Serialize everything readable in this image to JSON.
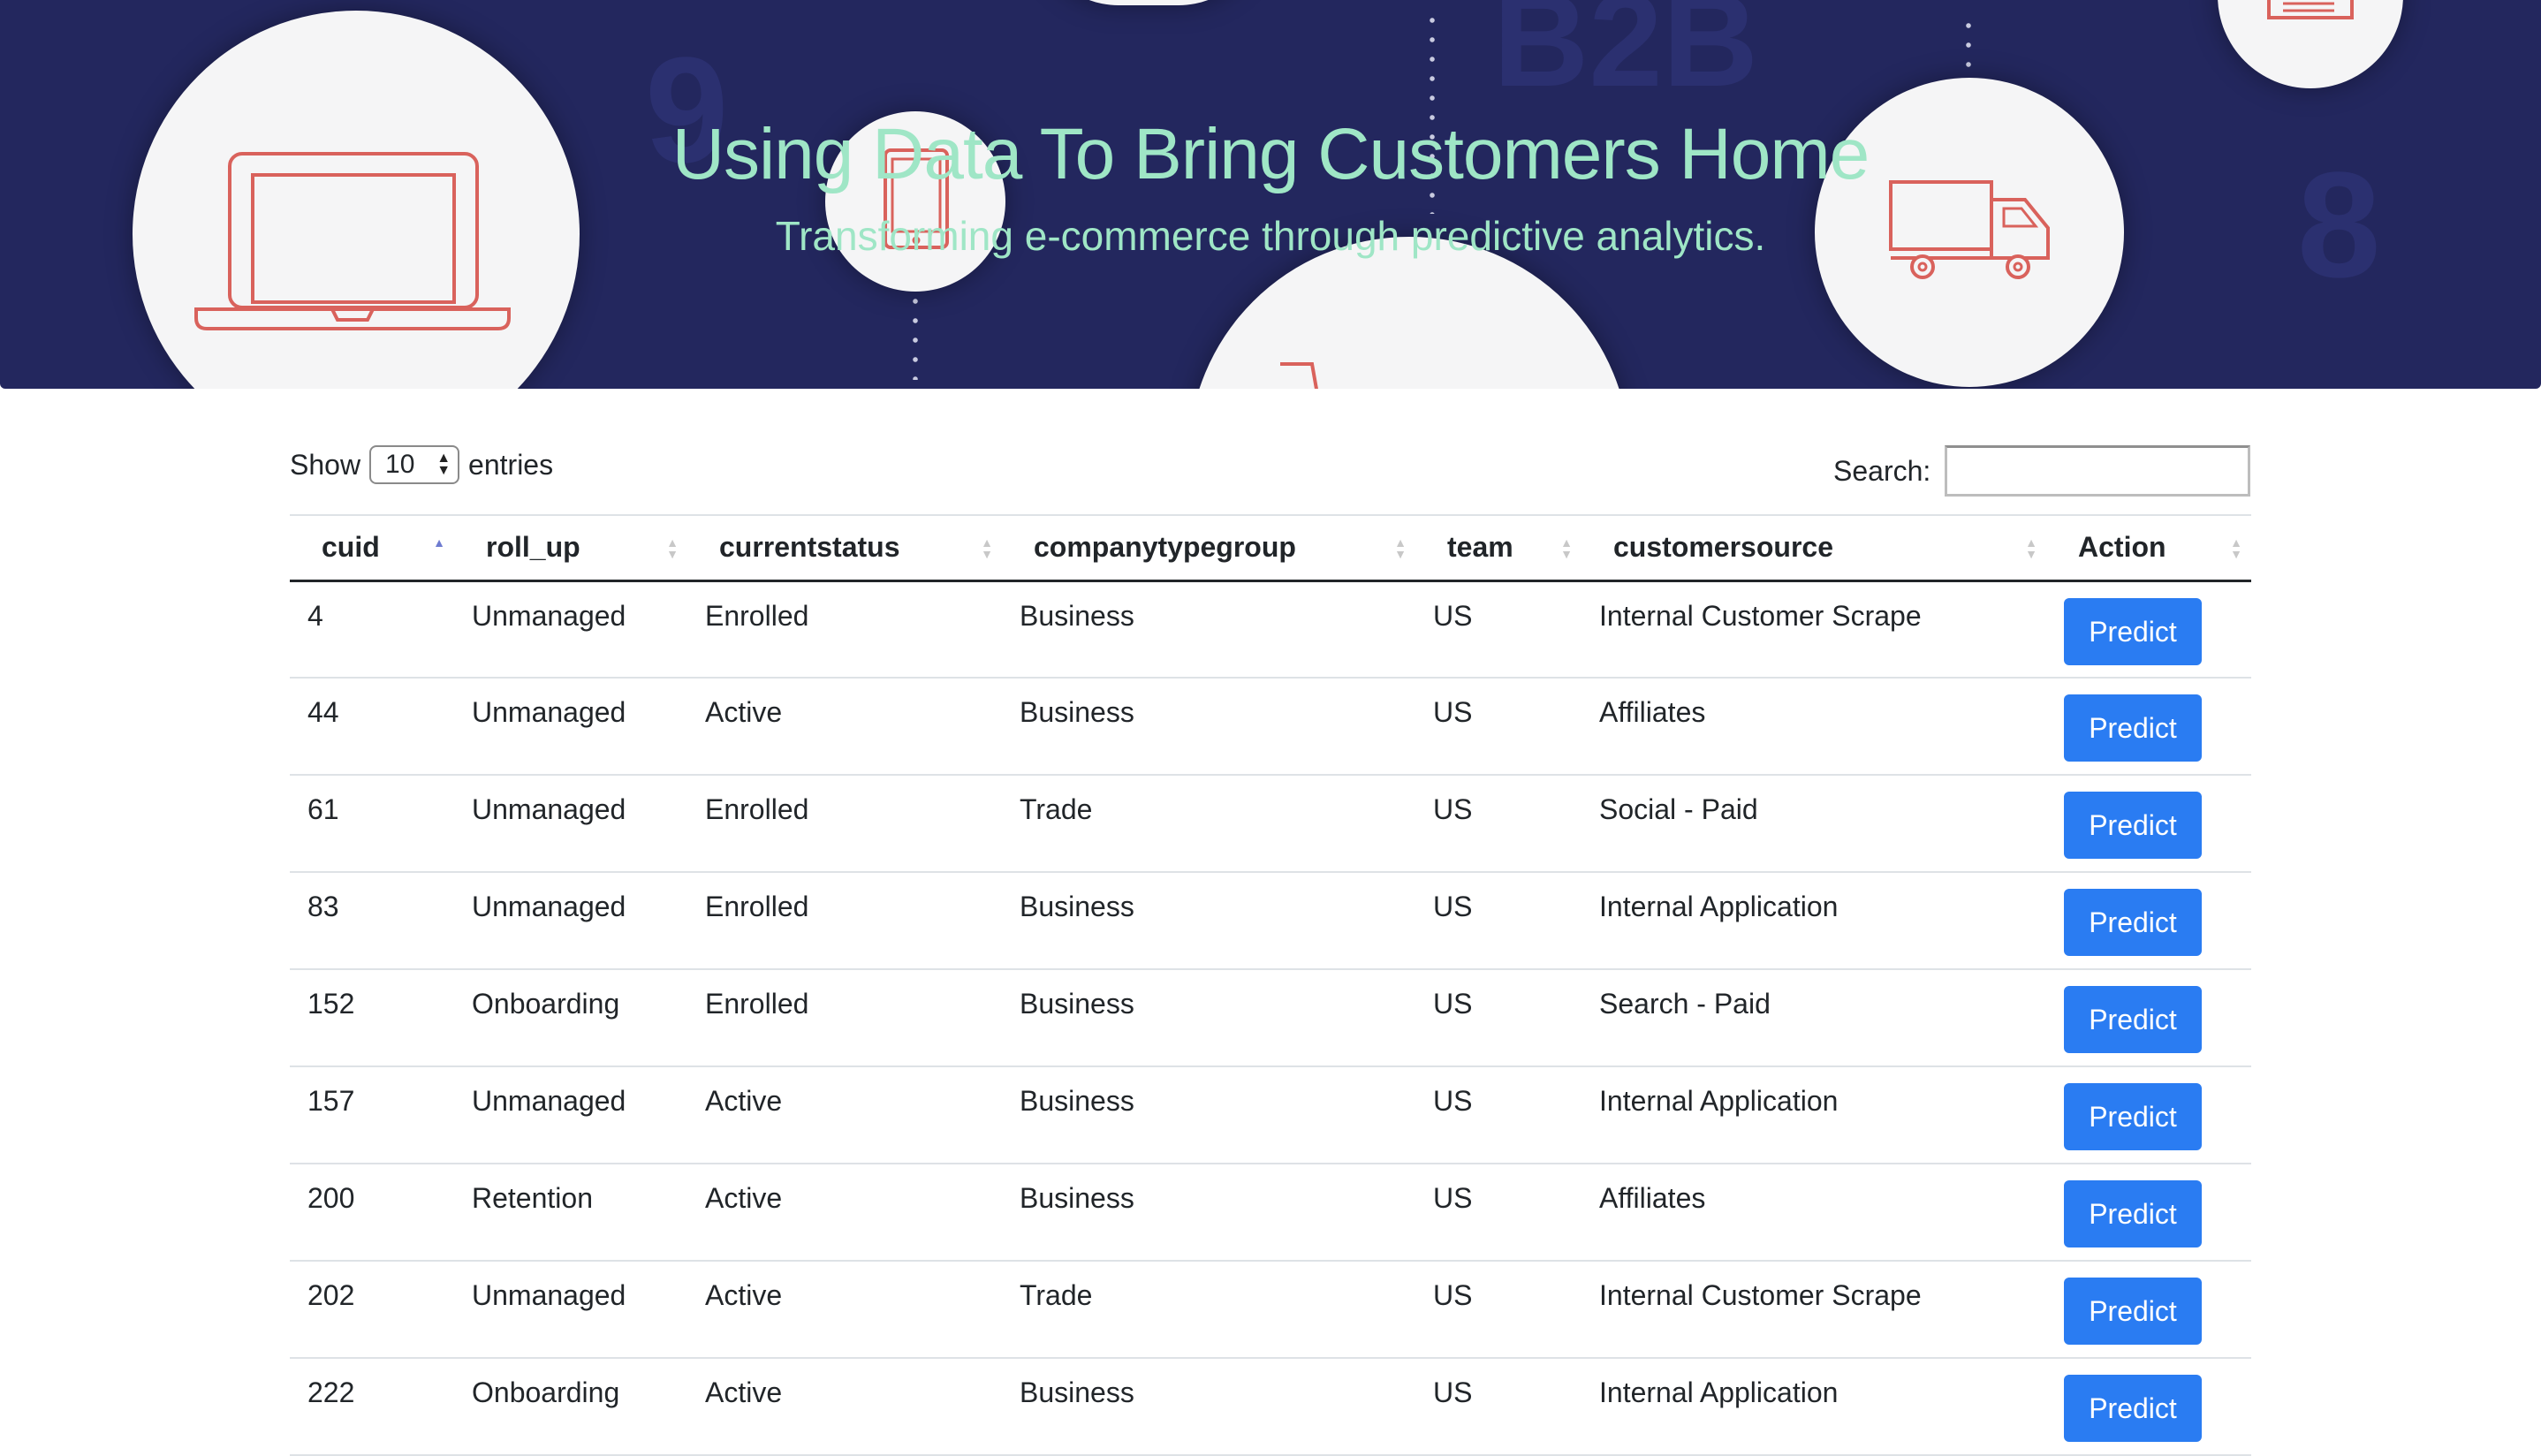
{
  "hero": {
    "title": "Using Data To Bring Customers Home",
    "subtitle": "Transforming e-commerce through predictive analytics.",
    "icons": [
      "laptop-icon",
      "tablet-icon",
      "truck-icon",
      "document-icon",
      "cart-icon"
    ],
    "colors": {
      "background": "#23275e",
      "heading": "#9fe6c6",
      "icon_stroke": "#d9625c"
    }
  },
  "controls": {
    "show_label": "Show",
    "entries_label": "entries",
    "page_length": "10",
    "search_label": "Search:",
    "search_value": ""
  },
  "table": {
    "columns": [
      "cuid",
      "roll_up",
      "currentstatus",
      "companytypegroup",
      "team",
      "customersource",
      "Action"
    ],
    "sorted_column": "cuid",
    "sort_direction": "ascending",
    "rows": [
      {
        "cuid": "4",
        "roll_up": "Unmanaged",
        "currentstatus": "Enrolled",
        "companytypegroup": "Business",
        "team": "US",
        "customersource": "Internal Customer Scrape",
        "action": "Predict"
      },
      {
        "cuid": "44",
        "roll_up": "Unmanaged",
        "currentstatus": "Active",
        "companytypegroup": "Business",
        "team": "US",
        "customersource": "Affiliates",
        "action": "Predict"
      },
      {
        "cuid": "61",
        "roll_up": "Unmanaged",
        "currentstatus": "Enrolled",
        "companytypegroup": "Trade",
        "team": "US",
        "customersource": "Social - Paid",
        "action": "Predict"
      },
      {
        "cuid": "83",
        "roll_up": "Unmanaged",
        "currentstatus": "Enrolled",
        "companytypegroup": "Business",
        "team": "US",
        "customersource": "Internal Application",
        "action": "Predict"
      },
      {
        "cuid": "152",
        "roll_up": "Onboarding",
        "currentstatus": "Enrolled",
        "companytypegroup": "Business",
        "team": "US",
        "customersource": "Search - Paid",
        "action": "Predict"
      },
      {
        "cuid": "157",
        "roll_up": "Unmanaged",
        "currentstatus": "Active",
        "companytypegroup": "Business",
        "team": "US",
        "customersource": "Internal Application",
        "action": "Predict"
      },
      {
        "cuid": "200",
        "roll_up": "Retention",
        "currentstatus": "Active",
        "companytypegroup": "Business",
        "team": "US",
        "customersource": "Affiliates",
        "action": "Predict"
      },
      {
        "cuid": "202",
        "roll_up": "Unmanaged",
        "currentstatus": "Active",
        "companytypegroup": "Trade",
        "team": "US",
        "customersource": "Internal Customer Scrape",
        "action": "Predict"
      },
      {
        "cuid": "222",
        "roll_up": "Onboarding",
        "currentstatus": "Active",
        "companytypegroup": "Business",
        "team": "US",
        "customersource": "Internal Application",
        "action": "Predict"
      }
    ]
  },
  "colors": {
    "button": "#2a7cf2",
    "sort_active": "#6e7bd0"
  }
}
